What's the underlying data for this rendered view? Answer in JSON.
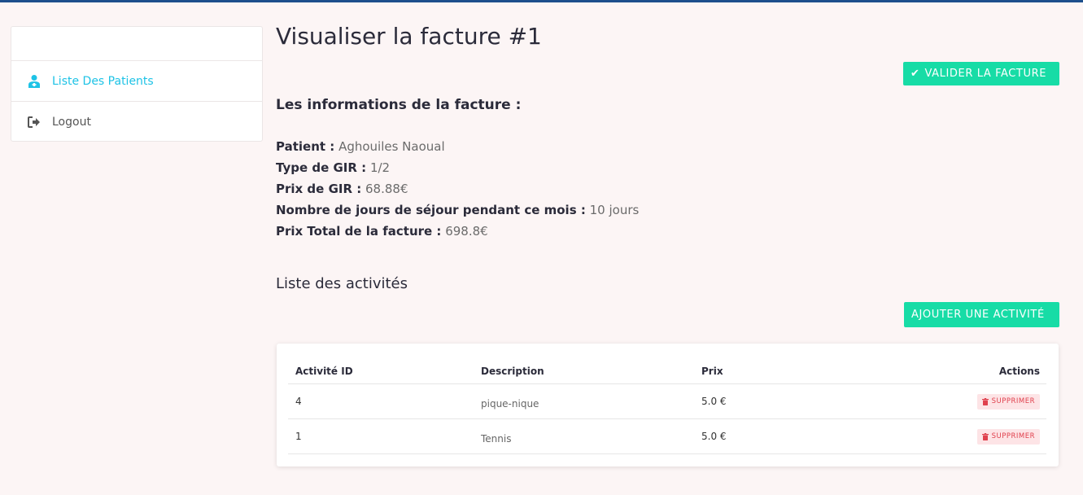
{
  "sidebar": {
    "items": [
      {
        "label": "Liste Des Patients",
        "icon": "patient-icon",
        "active": true
      },
      {
        "label": "Logout",
        "icon": "logout-icon",
        "active": false
      }
    ]
  },
  "page": {
    "title": "Visualiser la facture #1",
    "validate_button": "VALIDER LA FACTURE",
    "info_heading": "Les informations de la facture :"
  },
  "invoice": {
    "patient_label": "Patient :",
    "patient_value": "Aghouiles Naoual",
    "gir_type_label": "Type de GIR :",
    "gir_type_value": "1/2",
    "gir_price_label": "Prix de GIR :",
    "gir_price_value": "68.88€",
    "days_label": "Nombre de jours de séjour pendant ce mois :",
    "days_value": "10 jours",
    "total_label": "Prix Total de la facture :",
    "total_value": "698.8€"
  },
  "activities": {
    "title": "Liste des activités",
    "add_button": "AJOUTER UNE ACTIVITÉ",
    "columns": [
      "Activité ID",
      "Description",
      "Prix",
      "Actions"
    ],
    "rows": [
      {
        "id": "4",
        "description": "pique-nique",
        "price": "5.0 €",
        "action": "SUPPRIMER"
      },
      {
        "id": "1",
        "description": "Tennis",
        "price": "5.0 €",
        "action": "SUPPRIMER"
      }
    ]
  },
  "colors": {
    "accent_green": "#17dca6",
    "active_link": "#1ec3e6",
    "delete_red": "#e0404d",
    "topbar": "#1d4f8c"
  }
}
